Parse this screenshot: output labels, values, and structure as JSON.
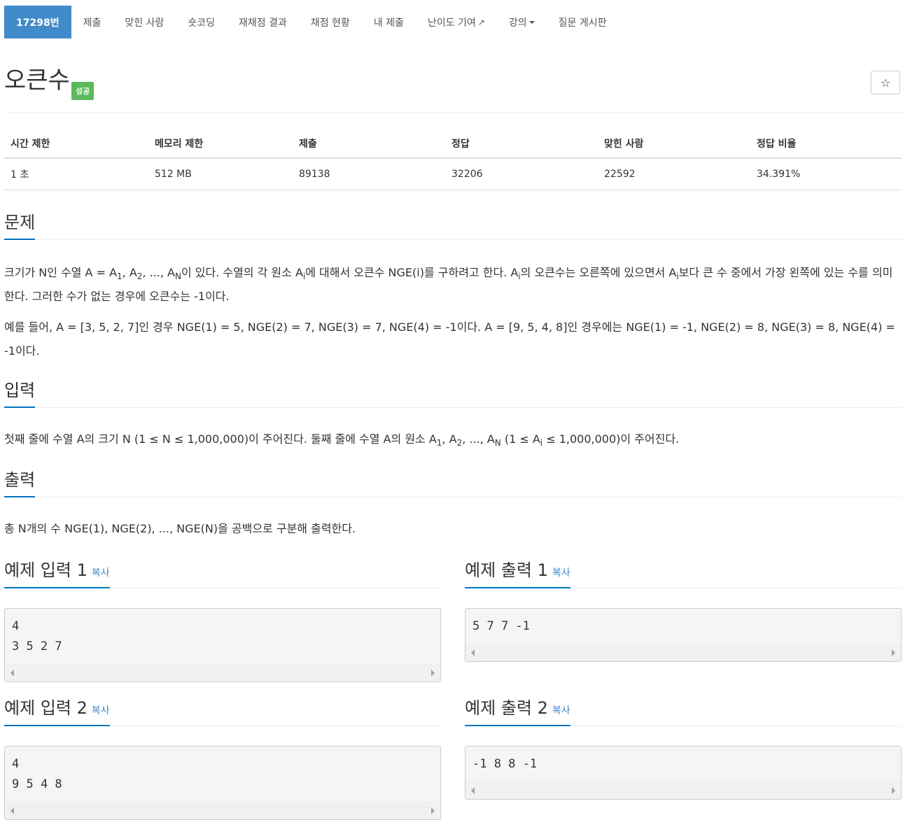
{
  "nav": {
    "tabs": [
      {
        "label": "17298번",
        "active": true
      },
      {
        "label": "제출"
      },
      {
        "label": "맞힌 사람"
      },
      {
        "label": "숏코딩"
      },
      {
        "label": "재채점 결과"
      },
      {
        "label": "채점 현황"
      },
      {
        "label": "내 제출"
      },
      {
        "label": "난이도 기여"
      },
      {
        "label": "강의"
      },
      {
        "label": "질문 게시판"
      }
    ]
  },
  "problem": {
    "title": "오큰수",
    "badge": "성공",
    "star": "☆"
  },
  "info": {
    "headers": [
      "시간 제한",
      "메모리 제한",
      "제출",
      "정답",
      "맞힌 사람",
      "정답 비율"
    ],
    "values": [
      "1 초",
      "512 MB",
      "89138",
      "32206",
      "22592",
      "34.391%"
    ]
  },
  "sections": {
    "problem_head": "문제",
    "p1_a": "크기가 N인 수열 A = A",
    "p1_b": ", A",
    "p1_c": ", ..., A",
    "p1_d": "이 있다. 수열의 각 원소 A",
    "p1_e": "에 대해서 오큰수 NGE(i)를 구하려고 한다. A",
    "p1_f": "의 오큰수는 오른쪽에 있으면서 A",
    "p1_g": "보다 큰 수 중에서 가장 왼쪽에 있는 수를 의미한다. 그러한 수가 없는 경우에 오큰수는 -1이다.",
    "p2": "예를 들어, A = [3, 5, 2, 7]인 경우 NGE(1) = 5, NGE(2) = 7, NGE(3) = 7, NGE(4) = -1이다. A = [9, 5, 4, 8]인 경우에는 NGE(1) = -1, NGE(2) = 8, NGE(3) = 8, NGE(4) = -1이다.",
    "input_head": "입력",
    "in_a": "첫째 줄에 수열 A의 크기 N (1 ≤ N ≤ 1,000,000)이 주어진다. 둘째 줄에 수열 A의 원소 A",
    "in_b": ", A",
    "in_c": ", ..., A",
    "in_d": " (1 ≤ A",
    "in_e": " ≤ 1,000,000)이 주어진다.",
    "output_head": "출력",
    "out": "총 N개의 수 NGE(1), NGE(2), ..., NGE(N)을 공백으로 구분해 출력한다.",
    "sub_1": "1",
    "sub_2": "2",
    "sub_N": "N",
    "sub_i": "i"
  },
  "samples": [
    {
      "title": "예제 입력 1",
      "copy": "복사",
      "code": "4\n3 5 2 7"
    },
    {
      "title": "예제 출력 1",
      "copy": "복사",
      "code": "5 7 7 -1"
    },
    {
      "title": "예제 입력 2",
      "copy": "복사",
      "code": "4\n9 5 4 8"
    },
    {
      "title": "예제 출력 2",
      "copy": "복사",
      "code": "-1 8 8 -1"
    }
  ],
  "colors": {
    "active_tab": "#428bca",
    "badge": "#5cb85c",
    "underline": "#0076c0"
  }
}
